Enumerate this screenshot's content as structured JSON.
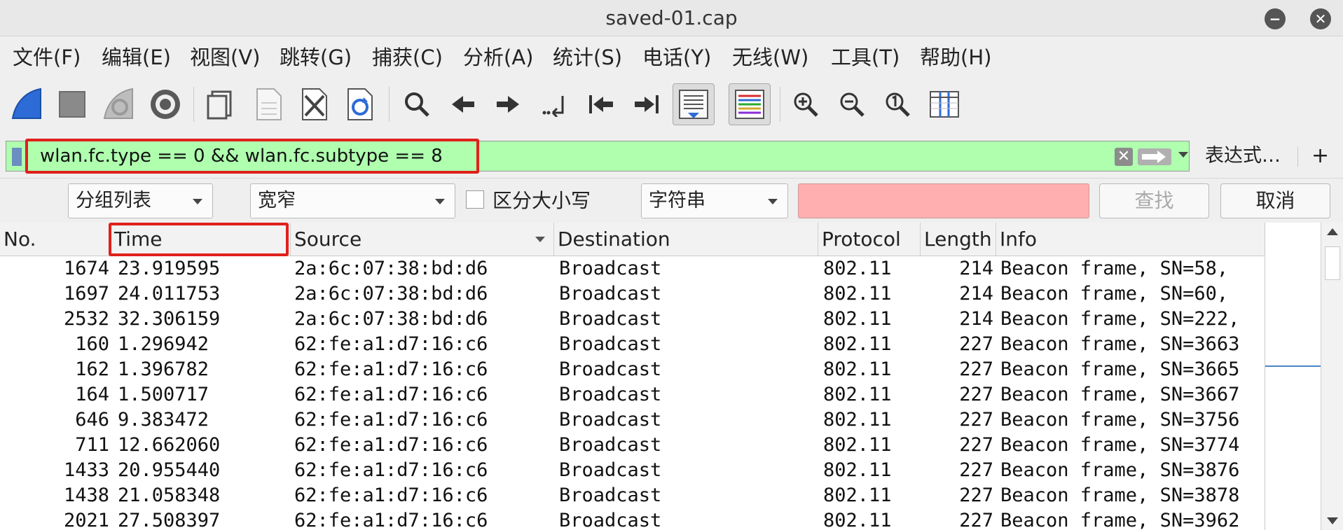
{
  "window": {
    "title": "saved-01.cap",
    "minimize_label": "−",
    "close_label": "✕"
  },
  "menu": [
    "文件(F)",
    "编辑(E)",
    "视图(V)",
    "跳转(G)",
    "捕获(C)",
    "分析(A)",
    "统计(S)",
    "电话(Y)",
    "无线(W)",
    "工具(T)",
    "帮助(H)"
  ],
  "toolbar": {
    "icons": [
      "shark-fin-start-icon",
      "stop-square-icon",
      "restart-capture-icon",
      "capture-options-gear-icon",
      "open-file-icon",
      "save-file-icon",
      "close-file-icon",
      "reload-file-icon",
      "find-packet-icon",
      "go-back-icon",
      "go-forward-icon",
      "go-to-packet-icon",
      "go-first-packet-icon",
      "go-last-packet-icon",
      "auto-scroll-icon",
      "colorize-icon",
      "zoom-in-icon",
      "zoom-out-icon",
      "normal-size-icon",
      "resize-columns-icon"
    ]
  },
  "filter": {
    "value": "wlan.fc.type == 0 && wlan.fc.subtype == 8",
    "expression_label": "表达式…",
    "add_label": "+"
  },
  "find": {
    "search_in": "分组列表",
    "char_width": "宽窄",
    "case_sensitive_label": "区分大小写",
    "search_type": "字符串",
    "search_value": "",
    "find_button": "查找",
    "cancel_button": "取消"
  },
  "packet_list": {
    "columns": [
      "No.",
      "Time",
      "Source",
      "Destination",
      "Protocol",
      "Length",
      "Info"
    ],
    "rows": [
      [
        "1674",
        "23.919595",
        "2a:6c:07:38:bd:d6",
        "Broadcast",
        "802.11",
        "214",
        "Beacon frame, SN=58,"
      ],
      [
        "1697",
        "24.011753",
        "2a:6c:07:38:bd:d6",
        "Broadcast",
        "802.11",
        "214",
        "Beacon frame, SN=60,"
      ],
      [
        "2532",
        "32.306159",
        "2a:6c:07:38:bd:d6",
        "Broadcast",
        "802.11",
        "214",
        "Beacon frame, SN=222,"
      ],
      [
        "160",
        "1.296942",
        "62:fe:a1:d7:16:c6",
        "Broadcast",
        "802.11",
        "227",
        "Beacon frame, SN=3663"
      ],
      [
        "162",
        "1.396782",
        "62:fe:a1:d7:16:c6",
        "Broadcast",
        "802.11",
        "227",
        "Beacon frame, SN=3665"
      ],
      [
        "164",
        "1.500717",
        "62:fe:a1:d7:16:c6",
        "Broadcast",
        "802.11",
        "227",
        "Beacon frame, SN=3667"
      ],
      [
        "646",
        "9.383472",
        "62:fe:a1:d7:16:c6",
        "Broadcast",
        "802.11",
        "227",
        "Beacon frame, SN=3756"
      ],
      [
        "711",
        "12.662060",
        "62:fe:a1:d7:16:c6",
        "Broadcast",
        "802.11",
        "227",
        "Beacon frame, SN=3774"
      ],
      [
        "1433",
        "20.955440",
        "62:fe:a1:d7:16:c6",
        "Broadcast",
        "802.11",
        "227",
        "Beacon frame, SN=3876"
      ],
      [
        "1438",
        "21.058348",
        "62:fe:a1:d7:16:c6",
        "Broadcast",
        "802.11",
        "227",
        "Beacon frame, SN=3878"
      ],
      [
        "2021",
        "27.508397",
        "62:fe:a1:d7:16:c6",
        "Broadcast",
        "802.11",
        "227",
        "Beacon frame, SN=3962"
      ]
    ]
  },
  "colors": {
    "filter_valid_bg": "#afffaf",
    "search_invalid_bg": "#ffafaf",
    "highlight_border": "#e0201b"
  }
}
